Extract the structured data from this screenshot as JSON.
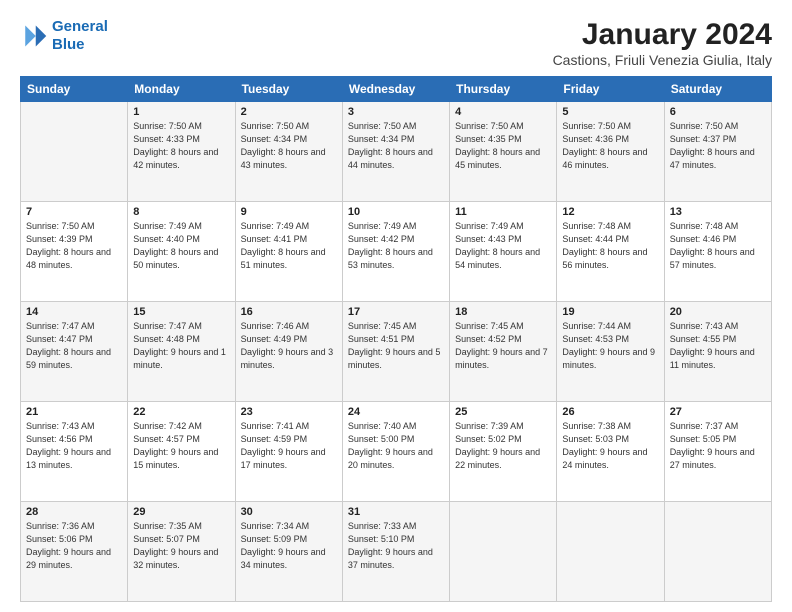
{
  "logo": {
    "line1": "General",
    "line2": "Blue"
  },
  "title": "January 2024",
  "subtitle": "Castions, Friuli Venezia Giulia, Italy",
  "weekdays": [
    "Sunday",
    "Monday",
    "Tuesday",
    "Wednesday",
    "Thursday",
    "Friday",
    "Saturday"
  ],
  "weeks": [
    [
      {
        "day": "",
        "sunrise": "",
        "sunset": "",
        "daylight": ""
      },
      {
        "day": "1",
        "sunrise": "Sunrise: 7:50 AM",
        "sunset": "Sunset: 4:33 PM",
        "daylight": "Daylight: 8 hours and 42 minutes."
      },
      {
        "day": "2",
        "sunrise": "Sunrise: 7:50 AM",
        "sunset": "Sunset: 4:34 PM",
        "daylight": "Daylight: 8 hours and 43 minutes."
      },
      {
        "day": "3",
        "sunrise": "Sunrise: 7:50 AM",
        "sunset": "Sunset: 4:34 PM",
        "daylight": "Daylight: 8 hours and 44 minutes."
      },
      {
        "day": "4",
        "sunrise": "Sunrise: 7:50 AM",
        "sunset": "Sunset: 4:35 PM",
        "daylight": "Daylight: 8 hours and 45 minutes."
      },
      {
        "day": "5",
        "sunrise": "Sunrise: 7:50 AM",
        "sunset": "Sunset: 4:36 PM",
        "daylight": "Daylight: 8 hours and 46 minutes."
      },
      {
        "day": "6",
        "sunrise": "Sunrise: 7:50 AM",
        "sunset": "Sunset: 4:37 PM",
        "daylight": "Daylight: 8 hours and 47 minutes."
      }
    ],
    [
      {
        "day": "7",
        "sunrise": "Sunrise: 7:50 AM",
        "sunset": "Sunset: 4:39 PM",
        "daylight": "Daylight: 8 hours and 48 minutes."
      },
      {
        "day": "8",
        "sunrise": "Sunrise: 7:49 AM",
        "sunset": "Sunset: 4:40 PM",
        "daylight": "Daylight: 8 hours and 50 minutes."
      },
      {
        "day": "9",
        "sunrise": "Sunrise: 7:49 AM",
        "sunset": "Sunset: 4:41 PM",
        "daylight": "Daylight: 8 hours and 51 minutes."
      },
      {
        "day": "10",
        "sunrise": "Sunrise: 7:49 AM",
        "sunset": "Sunset: 4:42 PM",
        "daylight": "Daylight: 8 hours and 53 minutes."
      },
      {
        "day": "11",
        "sunrise": "Sunrise: 7:49 AM",
        "sunset": "Sunset: 4:43 PM",
        "daylight": "Daylight: 8 hours and 54 minutes."
      },
      {
        "day": "12",
        "sunrise": "Sunrise: 7:48 AM",
        "sunset": "Sunset: 4:44 PM",
        "daylight": "Daylight: 8 hours and 56 minutes."
      },
      {
        "day": "13",
        "sunrise": "Sunrise: 7:48 AM",
        "sunset": "Sunset: 4:46 PM",
        "daylight": "Daylight: 8 hours and 57 minutes."
      }
    ],
    [
      {
        "day": "14",
        "sunrise": "Sunrise: 7:47 AM",
        "sunset": "Sunset: 4:47 PM",
        "daylight": "Daylight: 8 hours and 59 minutes."
      },
      {
        "day": "15",
        "sunrise": "Sunrise: 7:47 AM",
        "sunset": "Sunset: 4:48 PM",
        "daylight": "Daylight: 9 hours and 1 minute."
      },
      {
        "day": "16",
        "sunrise": "Sunrise: 7:46 AM",
        "sunset": "Sunset: 4:49 PM",
        "daylight": "Daylight: 9 hours and 3 minutes."
      },
      {
        "day": "17",
        "sunrise": "Sunrise: 7:45 AM",
        "sunset": "Sunset: 4:51 PM",
        "daylight": "Daylight: 9 hours and 5 minutes."
      },
      {
        "day": "18",
        "sunrise": "Sunrise: 7:45 AM",
        "sunset": "Sunset: 4:52 PM",
        "daylight": "Daylight: 9 hours and 7 minutes."
      },
      {
        "day": "19",
        "sunrise": "Sunrise: 7:44 AM",
        "sunset": "Sunset: 4:53 PM",
        "daylight": "Daylight: 9 hours and 9 minutes."
      },
      {
        "day": "20",
        "sunrise": "Sunrise: 7:43 AM",
        "sunset": "Sunset: 4:55 PM",
        "daylight": "Daylight: 9 hours and 11 minutes."
      }
    ],
    [
      {
        "day": "21",
        "sunrise": "Sunrise: 7:43 AM",
        "sunset": "Sunset: 4:56 PM",
        "daylight": "Daylight: 9 hours and 13 minutes."
      },
      {
        "day": "22",
        "sunrise": "Sunrise: 7:42 AM",
        "sunset": "Sunset: 4:57 PM",
        "daylight": "Daylight: 9 hours and 15 minutes."
      },
      {
        "day": "23",
        "sunrise": "Sunrise: 7:41 AM",
        "sunset": "Sunset: 4:59 PM",
        "daylight": "Daylight: 9 hours and 17 minutes."
      },
      {
        "day": "24",
        "sunrise": "Sunrise: 7:40 AM",
        "sunset": "Sunset: 5:00 PM",
        "daylight": "Daylight: 9 hours and 20 minutes."
      },
      {
        "day": "25",
        "sunrise": "Sunrise: 7:39 AM",
        "sunset": "Sunset: 5:02 PM",
        "daylight": "Daylight: 9 hours and 22 minutes."
      },
      {
        "day": "26",
        "sunrise": "Sunrise: 7:38 AM",
        "sunset": "Sunset: 5:03 PM",
        "daylight": "Daylight: 9 hours and 24 minutes."
      },
      {
        "day": "27",
        "sunrise": "Sunrise: 7:37 AM",
        "sunset": "Sunset: 5:05 PM",
        "daylight": "Daylight: 9 hours and 27 minutes."
      }
    ],
    [
      {
        "day": "28",
        "sunrise": "Sunrise: 7:36 AM",
        "sunset": "Sunset: 5:06 PM",
        "daylight": "Daylight: 9 hours and 29 minutes."
      },
      {
        "day": "29",
        "sunrise": "Sunrise: 7:35 AM",
        "sunset": "Sunset: 5:07 PM",
        "daylight": "Daylight: 9 hours and 32 minutes."
      },
      {
        "day": "30",
        "sunrise": "Sunrise: 7:34 AM",
        "sunset": "Sunset: 5:09 PM",
        "daylight": "Daylight: 9 hours and 34 minutes."
      },
      {
        "day": "31",
        "sunrise": "Sunrise: 7:33 AM",
        "sunset": "Sunset: 5:10 PM",
        "daylight": "Daylight: 9 hours and 37 minutes."
      },
      {
        "day": "",
        "sunrise": "",
        "sunset": "",
        "daylight": ""
      },
      {
        "day": "",
        "sunrise": "",
        "sunset": "",
        "daylight": ""
      },
      {
        "day": "",
        "sunrise": "",
        "sunset": "",
        "daylight": ""
      }
    ]
  ]
}
